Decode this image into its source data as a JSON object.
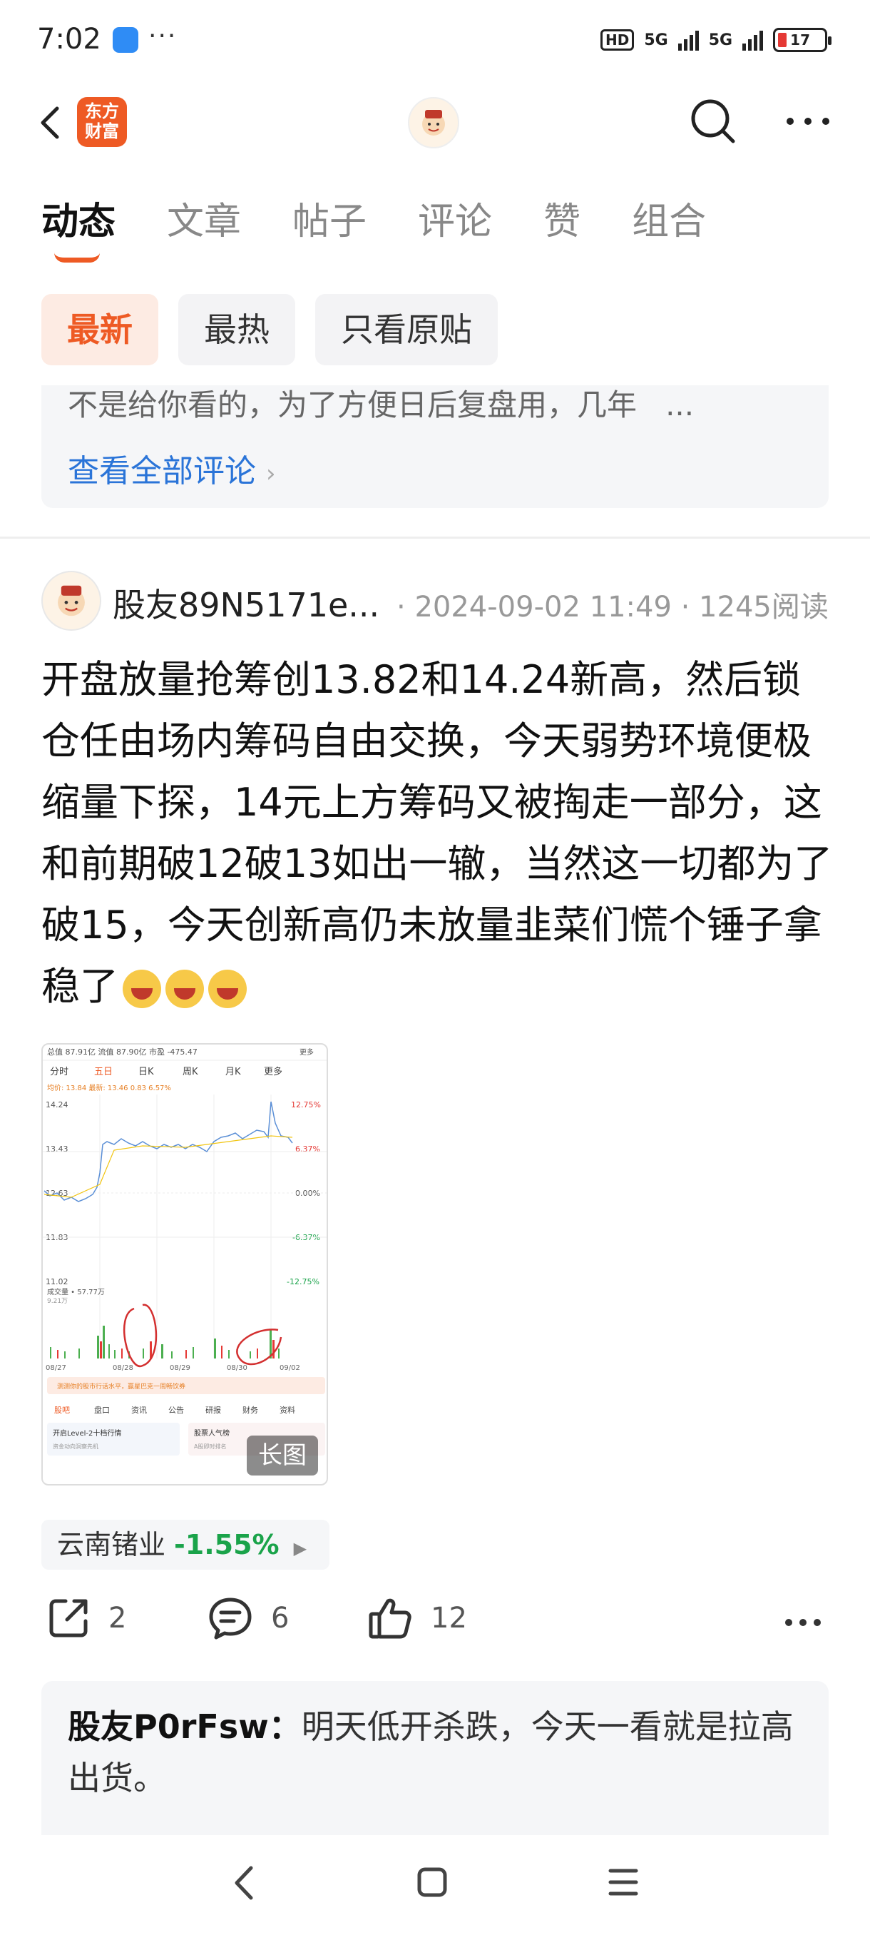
{
  "status_bar": {
    "time": "7:02",
    "dots": "···",
    "hd": "HD",
    "net1": "5G",
    "net2": "5G",
    "battery": "17"
  },
  "header": {
    "logo_text_line1": "东方",
    "logo_text_line2": "财富"
  },
  "tabs": [
    {
      "label": "动态",
      "active": true
    },
    {
      "label": "文章"
    },
    {
      "label": "帖子"
    },
    {
      "label": "评论"
    },
    {
      "label": "赞"
    },
    {
      "label": "组合"
    }
  ],
  "filters": [
    {
      "label": "最新",
      "active": true
    },
    {
      "label": "最热"
    },
    {
      "label": "只看原贴"
    }
  ],
  "prev_comment": {
    "text": "不是给你看的，为了方便日后复盘用，几年",
    "ellipsis": "...",
    "view_all": "查看全部评论"
  },
  "post": {
    "username": "股友89N5171e...",
    "datetime": "2024-09-02 11:49",
    "reads": "1245阅读",
    "body": "开盘放量抢筹创13.82和14.24新高，然后锁仓任由场内筹码自由交换，今天弱势环境便极缩量下探，14元上方筹码又被掏走一部分，这和前期破12破13如出一辙，当然这一切都为了破15，今天创新高仍未放量韭菜们慌个锤子拿稳了",
    "image_badge": "长图",
    "stock_name": "云南锗业",
    "stock_change": "-1.55%",
    "share_count": "2",
    "comment_count": "6",
    "like_count": "12"
  },
  "chart_thumb": {
    "header": "总值 87.91亿  流值 87.90亿  市盈 -475.47",
    "more": "更多",
    "tabs": [
      "分时",
      "五日",
      "日K",
      "周K",
      "月K",
      "更多"
    ],
    "price_info": "均价: 13.84  最新: 13.46  0.83  6.57%",
    "y_left": [
      "14.24",
      "13.43",
      "12.63",
      "11.83",
      "11.02"
    ],
    "y_right": [
      "12.75%",
      "6.37%",
      "0.00%",
      "-6.37%",
      "-12.75%"
    ],
    "volume_label": "成交量 • 57.77万",
    "volume_max": "9.21万",
    "dates": [
      "08/27",
      "08/28",
      "08/29",
      "08/30",
      "09/02"
    ],
    "banner": "测测你的股市行话水平，赢星巴克一周畅饮券",
    "bottom_tabs": [
      "股吧",
      "盘口",
      "资讯",
      "公告",
      "研报",
      "财务",
      "资料"
    ],
    "promo1": "开启Level-2十档行情",
    "promo1_sub": "资金动向洞察先机",
    "promo2": "股票人气榜",
    "promo2_sub": "A股即时排名"
  },
  "reply": {
    "user": "股友P0rFsw：",
    "text": "明天低开杀跌，今天一看就是拉高出货。"
  },
  "colors": {
    "accent": "#ee5a24",
    "link": "#2a74d8",
    "down": "#1aa34a"
  }
}
